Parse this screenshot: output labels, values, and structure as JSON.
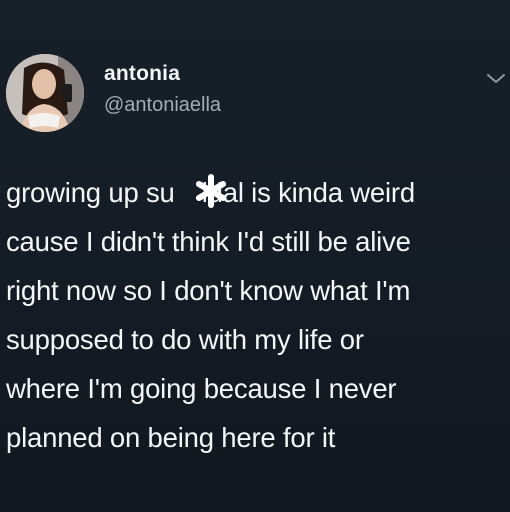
{
  "tweet": {
    "author_name": "antonia",
    "author_handle": "@antoniaella",
    "text": "growing up su  idal is kinda weird\ncause I didn't think I'd still be alive\nright now so I don't know what I'm\nsupposed to do with my life or\nwhere I'm going because I never\nplanned on being here for it",
    "menu_icon": "chevron-down-icon",
    "avatar_icon": "avatar"
  },
  "colors": {
    "background": "#151c26",
    "text": "#f4f6f8",
    "handle": "#a3acb6"
  }
}
